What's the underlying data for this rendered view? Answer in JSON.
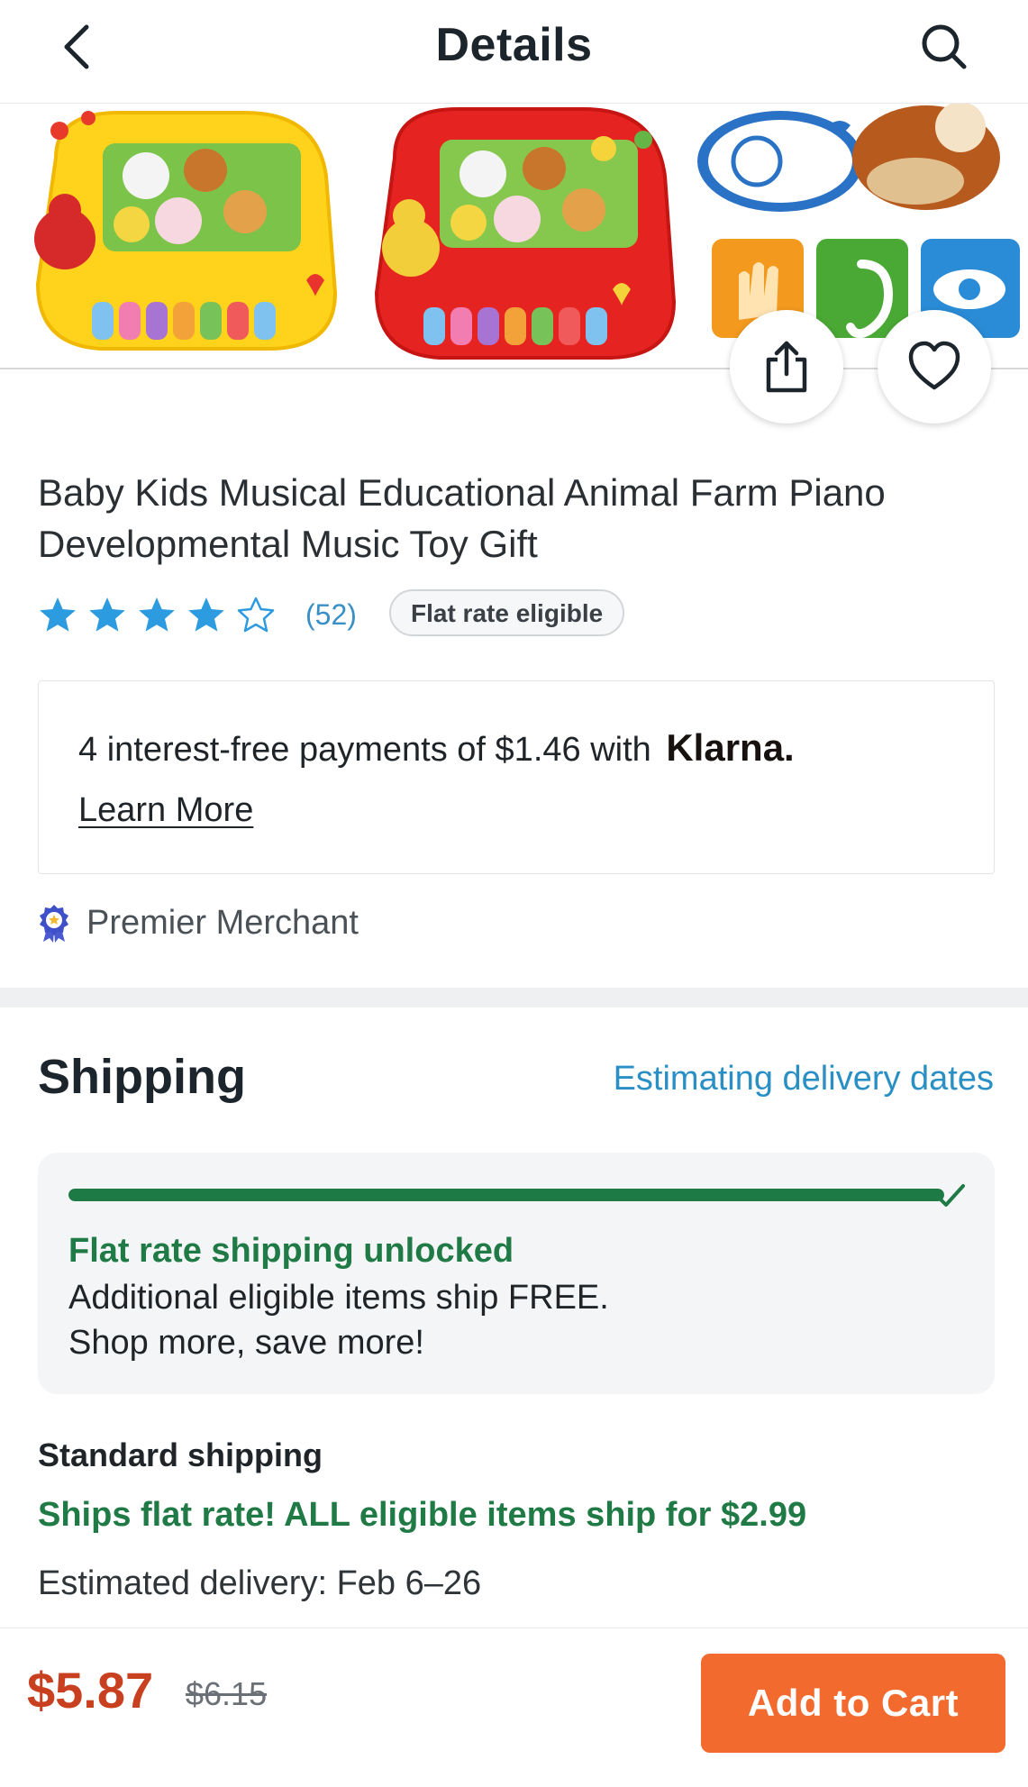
{
  "header": {
    "title": "Details",
    "back_icon": "chevron-left-icon",
    "search_icon": "search-icon"
  },
  "product": {
    "title": "Baby Kids Musical Educational Animal Farm Piano Developmental Music Toy Gift",
    "rating": 4,
    "rating_max": 5,
    "review_count": "(52)",
    "badge": "Flat rate eligible",
    "actions": {
      "share_icon": "share-icon",
      "favorite_icon": "heart-icon"
    }
  },
  "klarna": {
    "text": "4 interest-free payments of $1.46 with",
    "brand": "Klarna.",
    "learn_more": "Learn More"
  },
  "merchant": {
    "label": "Premier Merchant",
    "icon": "award-ribbon-icon"
  },
  "shipping": {
    "heading": "Shipping",
    "estimating": "Estimating delivery dates",
    "progress": 1.0,
    "unlocked_title": "Flat rate shipping unlocked",
    "unlocked_line1": "Additional eligible items ship FREE.",
    "unlocked_line2": "Shop more, save more!",
    "standard_heading": "Standard shipping",
    "standard_flat": "Ships flat rate! ALL eligible items ship for $2.99",
    "standard_estimate": "Estimated delivery: Feb 6–26"
  },
  "footer": {
    "price": "$5.87",
    "old_price": "$6.15",
    "add_to_cart": "Add to Cart"
  },
  "colors": {
    "accent_blue": "#2a8fc4",
    "star_blue": "#2d9be0",
    "success_green": "#1f7a45",
    "price_red": "#c8401f",
    "cta_orange": "#f26a2e"
  }
}
